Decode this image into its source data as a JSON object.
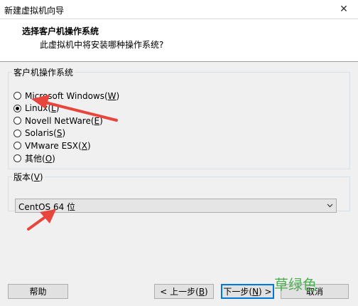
{
  "window": {
    "title": "新建虚拟机向导",
    "close_glyph": "✕"
  },
  "header": {
    "heading": "选择客户机操作系统",
    "subheading": "此虚拟机中将安装哪种操作系统?"
  },
  "os_group": {
    "legend": "客户机操作系统",
    "options": [
      {
        "label": "Microsoft Windows(",
        "key": "W",
        "tail": ")",
        "checked": false
      },
      {
        "label": "Linux(",
        "key": "L",
        "tail": ")",
        "checked": true
      },
      {
        "label": "Novell NetWare(",
        "key": "E",
        "tail": ")",
        "checked": false
      },
      {
        "label": "Solaris(",
        "key": "S",
        "tail": ")",
        "checked": false
      },
      {
        "label": "VMware ESX(",
        "key": "X",
        "tail": ")",
        "checked": false
      },
      {
        "label": "其他(",
        "key": "O",
        "tail": ")",
        "checked": false
      }
    ]
  },
  "version_group": {
    "legend_prefix": "版本(",
    "legend_key": "V",
    "legend_tail": ")",
    "selected": "CentOS 64 位"
  },
  "buttons": {
    "help": "帮助",
    "back_prefix": "< 上一步(",
    "back_key": "B",
    "back_tail": ")",
    "next_prefix": "下一步(",
    "next_key": "N",
    "next_tail": ") >",
    "cancel": "取消"
  },
  "watermark": "草绿色",
  "colors": {
    "annotation_arrow": "#e8453c",
    "watermark": "#4cb050",
    "default_button_border": "#0078d7"
  }
}
